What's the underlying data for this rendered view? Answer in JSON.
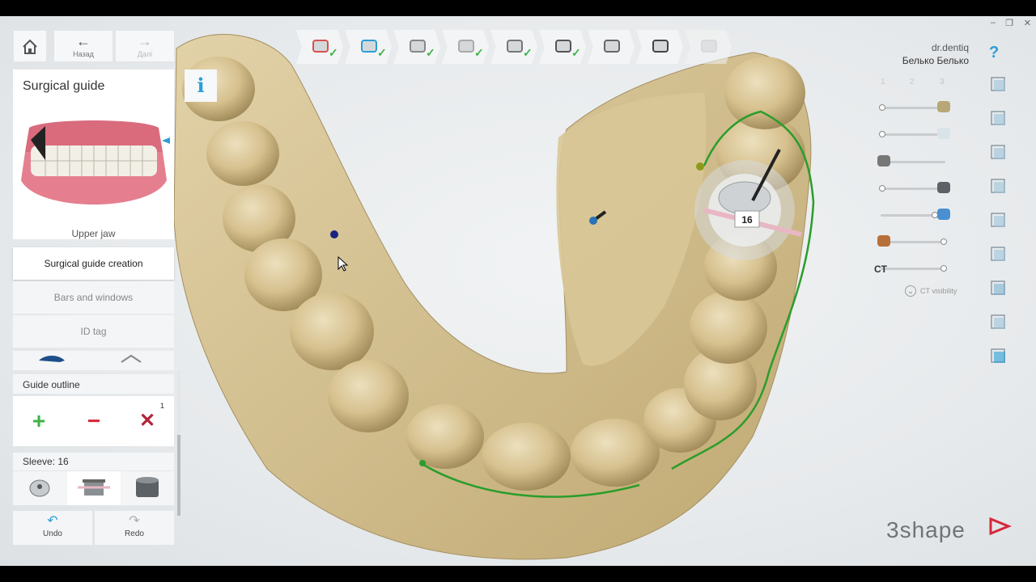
{
  "window": {
    "minimize_glyph": "–",
    "restore_glyph": "❐",
    "close_glyph": "✕"
  },
  "nav": {
    "home_icon": "home-icon",
    "back_label": "Назад",
    "forward_label": "Далі"
  },
  "panel": {
    "title": "Surgical guide",
    "jaw_label": "Upper jaw",
    "info_glyph": "i"
  },
  "menu": {
    "items": [
      {
        "label": "Surgical guide creation",
        "active": true
      },
      {
        "label": "Bars and windows",
        "active": false
      },
      {
        "label": "ID tag",
        "active": false
      }
    ]
  },
  "guide_outline": {
    "label": "Guide outline",
    "add_glyph": "+",
    "remove_glyph": "−",
    "clear_glyph": "✕",
    "clear_count": "1"
  },
  "sleeve": {
    "label": "Sleeve: 16"
  },
  "history": {
    "undo_label": "Undo",
    "redo_label": "Redo"
  },
  "workflow": {
    "steps": [
      {
        "icon": "order-form-icon",
        "done": true
      },
      {
        "icon": "scan-import-icon",
        "done": true
      },
      {
        "icon": "cut-icon",
        "done": true
      },
      {
        "icon": "tooth-icon",
        "done": true
      },
      {
        "icon": "alignment-icon",
        "done": true
      },
      {
        "icon": "implant-icon",
        "done": true
      },
      {
        "icon": "sleeve-icon",
        "done": false
      },
      {
        "icon": "guide-design-icon",
        "done": false
      },
      {
        "icon": "export-icon",
        "done": false
      }
    ]
  },
  "user": {
    "name": "dr.dentiq",
    "org": "Белько Белько",
    "help_glyph": "?"
  },
  "layers": {
    "tabs": [
      "1",
      "2",
      "3"
    ],
    "ct_label": "CT",
    "ct_visibility_label": "CT visibility"
  },
  "viewport": {
    "sleeve_number": "16"
  },
  "brand": {
    "logo_text": "3shape"
  },
  "colors": {
    "accent": "#2a9fd6",
    "add_green": "#3db34a",
    "remove_red": "#d6283b",
    "model_tan": "#d9c497",
    "guide_line": "#2a9d2a"
  }
}
